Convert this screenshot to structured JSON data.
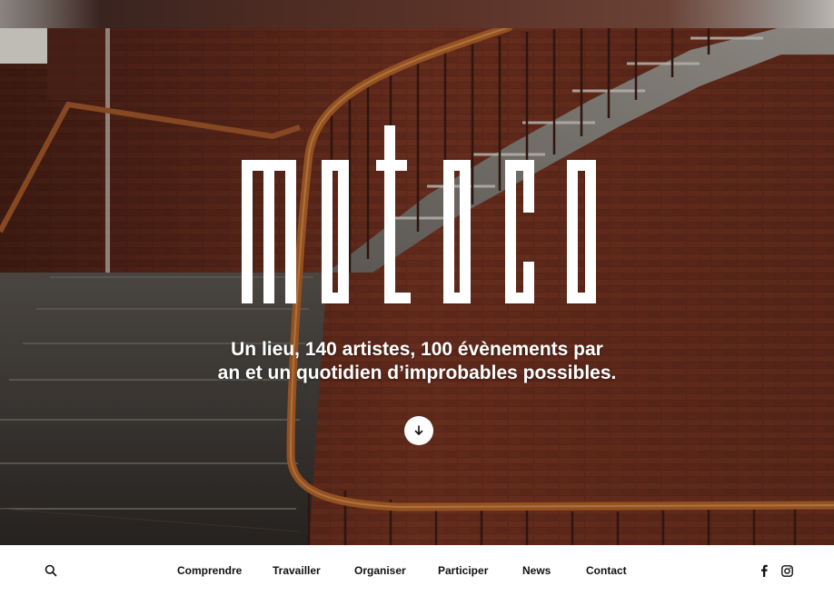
{
  "hero": {
    "logo_text": "motoco",
    "tagline_line1": "Un lieu, 140 artistes, 100 évènements par",
    "tagline_line2": "an et un quotidien d’improbables possibles.",
    "scroll_icon": "arrow-down-icon"
  },
  "nav": {
    "search_icon": "search-icon",
    "items": [
      {
        "label": "Comprendre"
      },
      {
        "label": "Travailler"
      },
      {
        "label": "Organiser"
      },
      {
        "label": "Participer"
      },
      {
        "label": "News"
      },
      {
        "label": "Contact"
      }
    ],
    "social": [
      {
        "icon": "facebook-icon"
      },
      {
        "icon": "instagram-icon"
      }
    ]
  },
  "colors": {
    "brick": "#6b2f20",
    "handrail": "#b5652a",
    "text_dark": "#111111",
    "white": "#ffffff"
  }
}
